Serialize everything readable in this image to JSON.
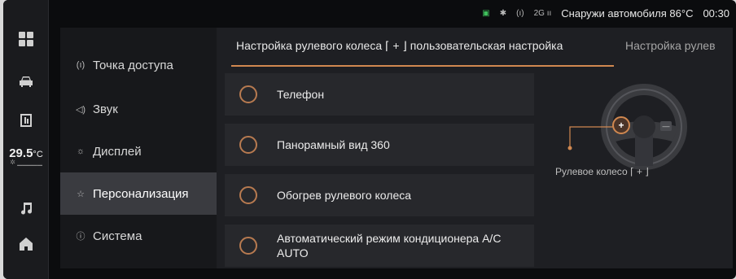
{
  "status_bar": {
    "icons": [
      "phone-connected-icon",
      "bluetooth-icon",
      "hotspot-icon",
      "signal-icon"
    ],
    "signal_label": "2G",
    "outside_label": "Снаружи автомобиля",
    "outside_temp": "86°C",
    "time": "00:30"
  },
  "rail": {
    "items": [
      "apps-icon",
      "car-icon",
      "parking-icon",
      "music-icon",
      "home-icon"
    ],
    "temp_value": "29.5",
    "temp_unit": "°C"
  },
  "menu": {
    "items": [
      {
        "icon": "hotspot-icon",
        "glyph": "(ı)",
        "label": "Точка доступа"
      },
      {
        "icon": "sound-icon",
        "glyph": "◁)",
        "label": "Звук"
      },
      {
        "icon": "display-icon",
        "glyph": "☼",
        "label": "Дисплей"
      },
      {
        "icon": "personalization-icon",
        "glyph": "☆",
        "label": "Персонализация",
        "active": true
      },
      {
        "icon": "system-icon",
        "glyph": "ⓘ",
        "label": "Система"
      }
    ]
  },
  "tabs": [
    {
      "label": "Настройка рулевого колеса ⌈ + ⌋ пользовательская настройка",
      "active": true
    },
    {
      "label": "Настройка рулев",
      "active": false
    }
  ],
  "options": [
    {
      "label": "Телефон"
    },
    {
      "label": "Панорамный вид 360"
    },
    {
      "label": "Обогрев рулевого колеса"
    },
    {
      "label_line1": "Автоматический режим кондиционера A/C",
      "label_line2": "AUTO"
    }
  ],
  "wheel": {
    "caption": "Рулевое колесо ⌈ + ⌋",
    "accent_color": "#d08850"
  }
}
